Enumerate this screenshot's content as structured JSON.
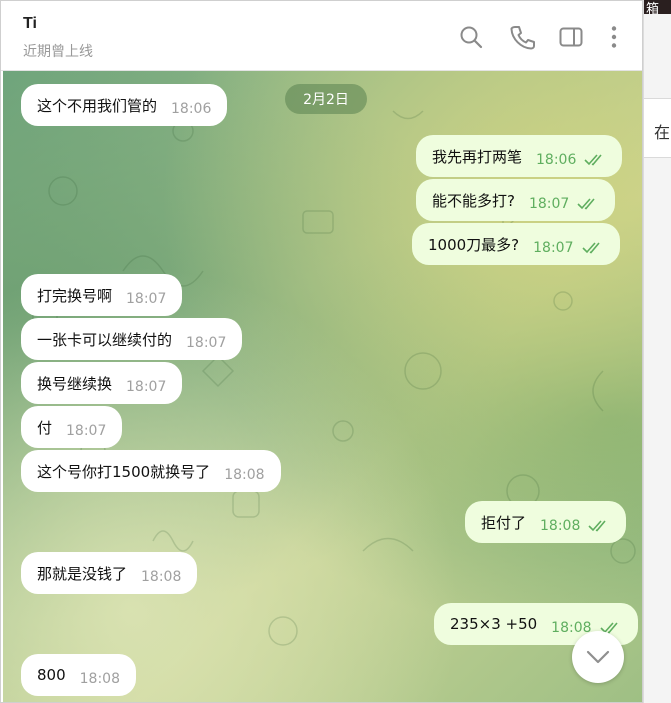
{
  "header": {
    "contact_name": "Ti",
    "status": "近期曾上线"
  },
  "background_window": {
    "top_text": "箱",
    "side_text": "在"
  },
  "date_pill": "2月2日",
  "messages": [
    {
      "dir": "in",
      "text": "这个不用我们管的",
      "time": "18:06"
    },
    {
      "dir": "out",
      "text": "我先再打两笔",
      "time": "18:06",
      "read": true
    },
    {
      "dir": "out",
      "text": "能不能多打?",
      "time": "18:07",
      "read": true
    },
    {
      "dir": "out",
      "text": "1000刀最多?",
      "time": "18:07",
      "read": true
    },
    {
      "dir": "in",
      "text": "打完换号啊",
      "time": "18:07"
    },
    {
      "dir": "in",
      "text": "一张卡可以继续付的",
      "time": "18:07"
    },
    {
      "dir": "in",
      "text": "换号继续换",
      "time": "18:07"
    },
    {
      "dir": "in",
      "text": "付",
      "time": "18:07"
    },
    {
      "dir": "in",
      "text": "这个号你打1500就换号了",
      "time": "18:08"
    },
    {
      "dir": "out",
      "text": "拒付了",
      "time": "18:08",
      "read": true
    },
    {
      "dir": "in",
      "text": "那就是没钱了",
      "time": "18:08"
    },
    {
      "dir": "out",
      "text": "235×3  +50",
      "time": "18:08",
      "read": true
    },
    {
      "dir": "in",
      "text": "800",
      "time": "18:08"
    }
  ],
  "icons": {
    "search": "search-icon",
    "call": "phone-icon",
    "sidebar": "sidebar-toggle-icon",
    "more": "more-vertical-icon",
    "scroll_down": "chevron-down-icon",
    "read": "double-check-icon"
  },
  "colors": {
    "incoming_bubble": "#ffffff",
    "outgoing_bubble": "#effdde",
    "outgoing_time": "#5fae5f",
    "date_pill_bg": "#6a9460"
  }
}
